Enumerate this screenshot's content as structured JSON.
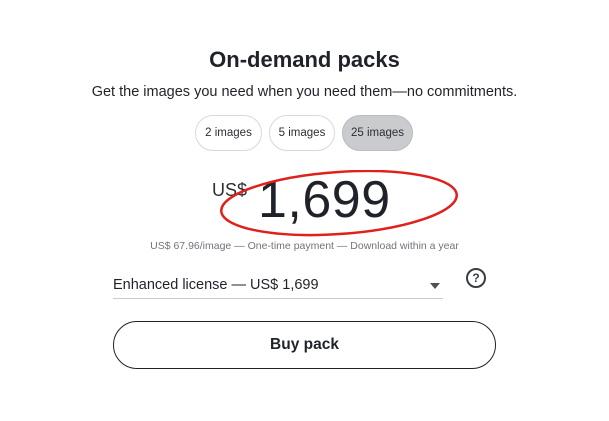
{
  "header": {
    "title": "On-demand packs",
    "subtitle": "Get the images you need when you need them—no commitments."
  },
  "packs": {
    "options": [
      {
        "label": "2 images",
        "selected": false
      },
      {
        "label": "5 images",
        "selected": false
      },
      {
        "label": "25 images",
        "selected": true
      }
    ]
  },
  "price": {
    "currency": "US$",
    "amount": "1,699",
    "details": "US$ 67.96/image — One-time payment — Download within a year"
  },
  "license": {
    "selected": "Enhanced license — US$ 1,699",
    "help_icon": "question-circle-icon"
  },
  "actions": {
    "buy_label": "Buy pack"
  },
  "annotation": {
    "color": "#e0201b"
  }
}
